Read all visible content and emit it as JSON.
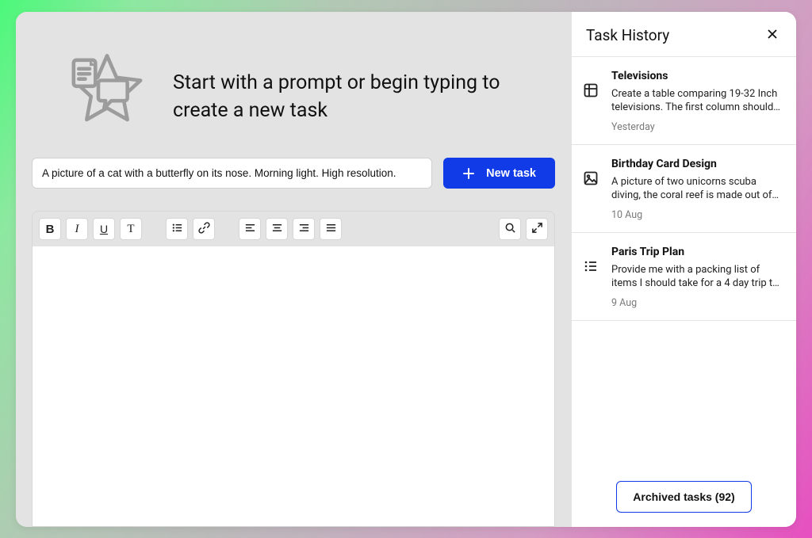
{
  "hero": {
    "title": "Start with a prompt or begin typing to create a new task"
  },
  "prompt": {
    "value": "A picture of a cat with a butterfly on its nose. Morning light. High resolution.",
    "button_label": "New task"
  },
  "toolbar": {
    "groups": [
      [
        "bold",
        "italic",
        "underline",
        "text-style"
      ],
      [
        "bullet-list",
        "link"
      ],
      [
        "align-left",
        "align-center",
        "align-right",
        "align-justify"
      ]
    ],
    "right": [
      "search",
      "expand"
    ]
  },
  "side": {
    "title": "Task History",
    "archived_label": "Archived tasks (92)",
    "items": [
      {
        "icon": "table",
        "title": "Televisions",
        "desc": "Create a table comparing 19-32 Inch televisions. The first column should…",
        "date": "Yesterday"
      },
      {
        "icon": "image",
        "title": "Birthday Card Design",
        "desc": "A picture of two unicorns scuba diving, the coral reef is made out of…",
        "date": "10 Aug"
      },
      {
        "icon": "list",
        "title": "Paris Trip Plan",
        "desc": "Provide me with a packing list of items I should take for a 4 day trip t…",
        "date": "9 Aug"
      }
    ]
  }
}
